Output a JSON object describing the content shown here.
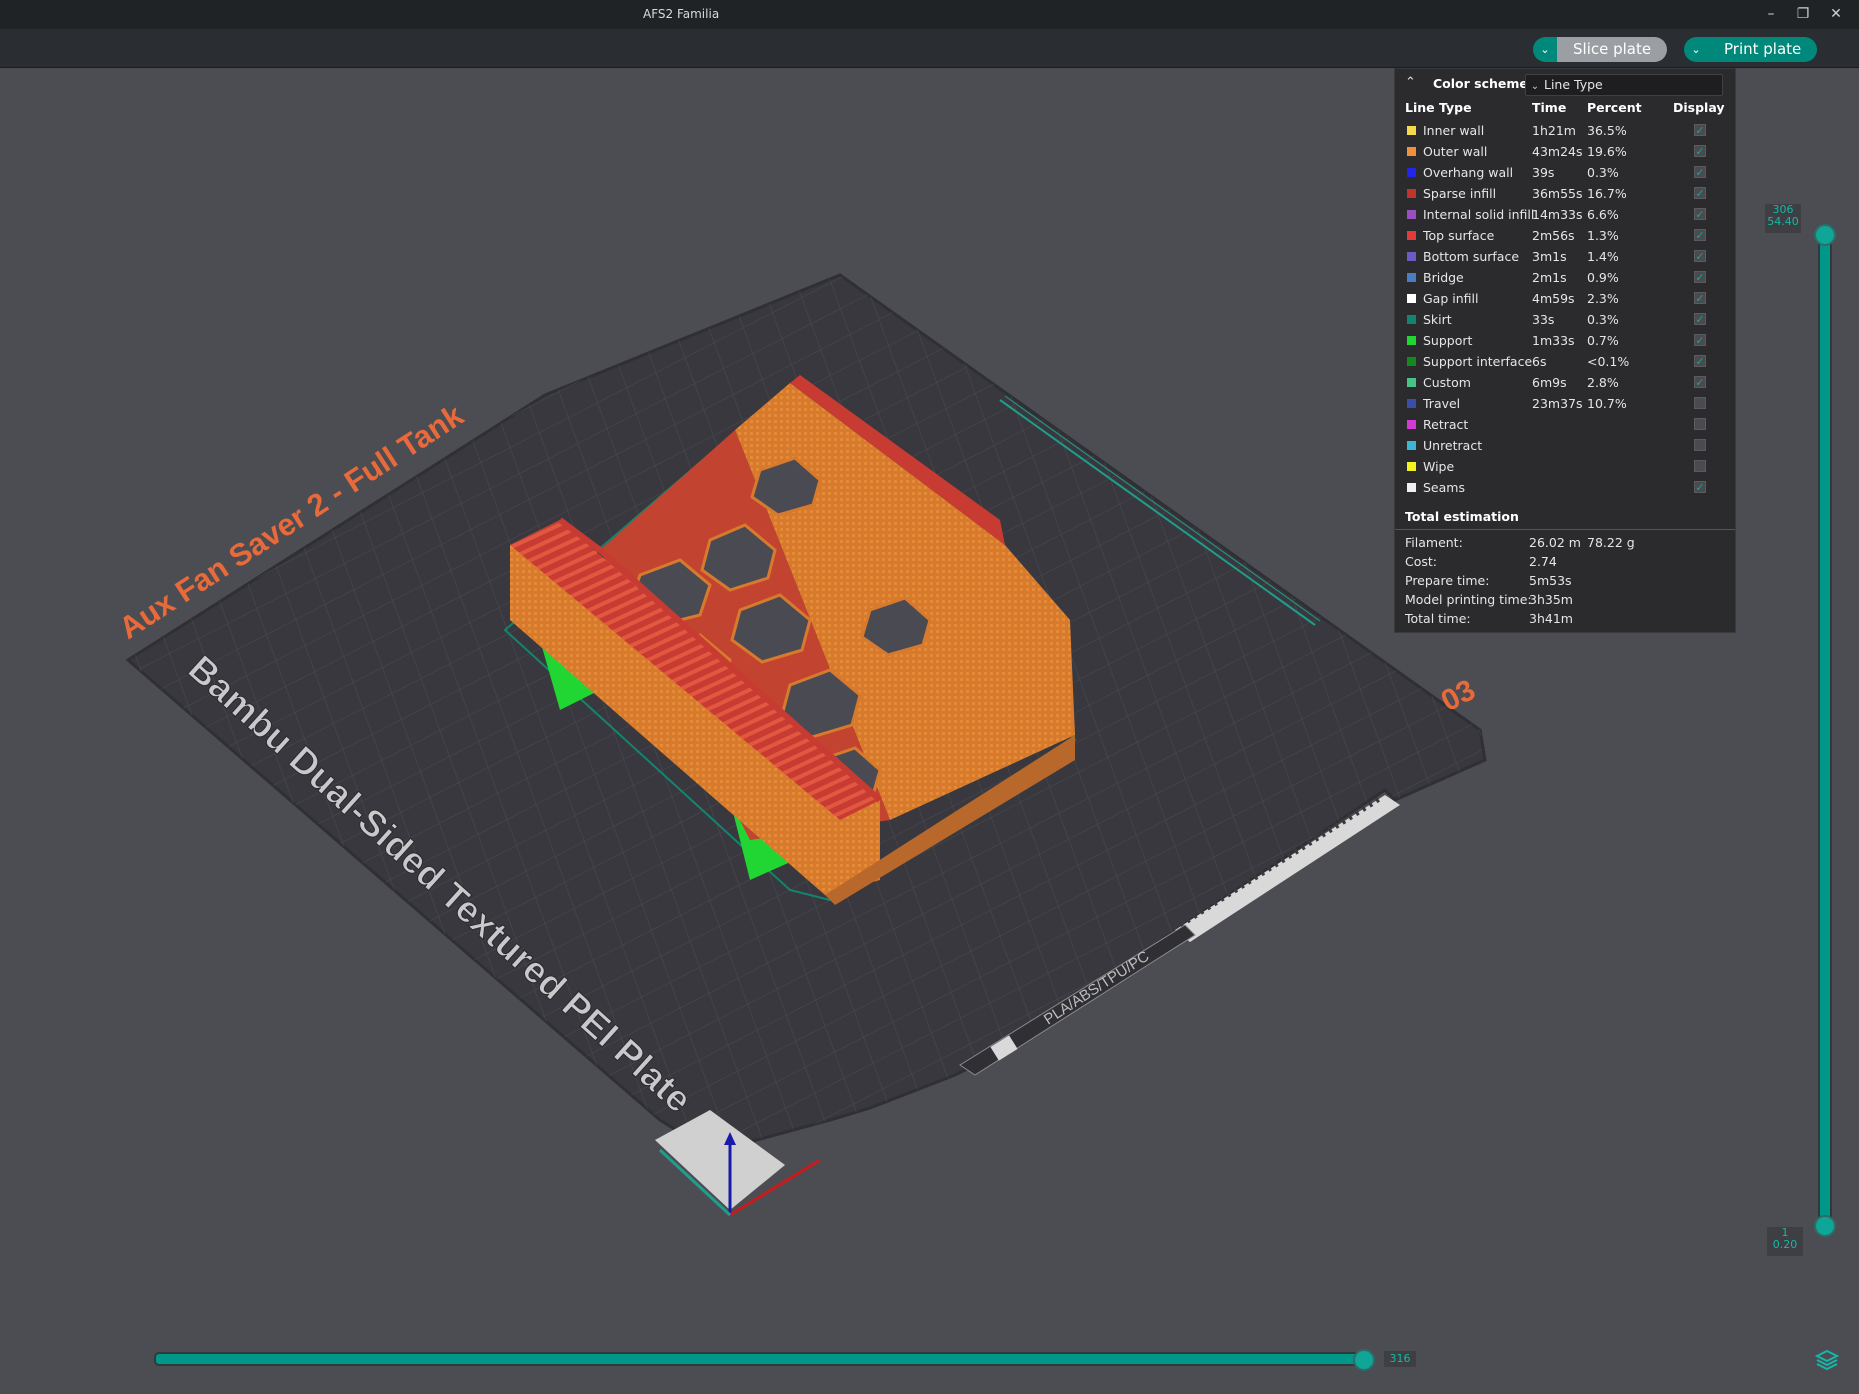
{
  "window": {
    "title": "AFS2 Familia",
    "controls": [
      "minimize-icon",
      "restore-icon",
      "close-icon"
    ]
  },
  "toolbar": {
    "slice_label": "Slice plate",
    "print_label": "Print plate",
    "accent_color": "#00897b"
  },
  "plate": {
    "model_name": "Aux Fan Saver 2 - Full Tank",
    "plate_type": "Bambu Dual-Sided Textured PEI Plate",
    "plate_number": "03",
    "material_label": "PLA/ABS/TPU/PC"
  },
  "legend": {
    "color_scheme_label": "Color scheme",
    "color_scheme_value": "Line Type",
    "headers": {
      "line_type": "Line Type",
      "time": "Time",
      "percent": "Percent",
      "display": "Display"
    },
    "rows": [
      {
        "name": "Inner wall",
        "time": "1h21m",
        "percent": "36.5%",
        "color": "#f5d94d",
        "display": true
      },
      {
        "name": "Outer wall",
        "time": "43m24s",
        "percent": "19.6%",
        "color": "#f08f3c",
        "display": true
      },
      {
        "name": "Overhang wall",
        "time": "39s",
        "percent": "0.3%",
        "color": "#2226e8",
        "display": true
      },
      {
        "name": "Sparse infill",
        "time": "36m55s",
        "percent": "16.7%",
        "color": "#c0342b",
        "display": true
      },
      {
        "name": "Internal solid infill",
        "time": "14m33s",
        "percent": "6.6%",
        "color": "#9a4fc0",
        "display": true
      },
      {
        "name": "Top surface",
        "time": "2m56s",
        "percent": "1.3%",
        "color": "#e23b3b",
        "display": true
      },
      {
        "name": "Bottom surface",
        "time": "3m1s",
        "percent": "1.4%",
        "color": "#6a5cc4",
        "display": true
      },
      {
        "name": "Bridge",
        "time": "2m1s",
        "percent": "0.9%",
        "color": "#4a7dc4",
        "display": true
      },
      {
        "name": "Gap infill",
        "time": "4m59s",
        "percent": "2.3%",
        "color": "#ffffff",
        "display": true
      },
      {
        "name": "Skirt",
        "time": "33s",
        "percent": "0.3%",
        "color": "#13846f",
        "display": true
      },
      {
        "name": "Support",
        "time": "1m33s",
        "percent": "0.7%",
        "color": "#21d633",
        "display": true
      },
      {
        "name": "Support interface",
        "time": "6s",
        "percent": "<0.1%",
        "color": "#138a1f",
        "display": true
      },
      {
        "name": "Custom",
        "time": "6m9s",
        "percent": "2.8%",
        "color": "#45c485",
        "display": true
      },
      {
        "name": "Travel",
        "time": "23m37s",
        "percent": "10.7%",
        "color": "#3a4ea8",
        "display": false
      },
      {
        "name": "Retract",
        "time": "",
        "percent": "",
        "color": "#d23bd1",
        "display": false
      },
      {
        "name": "Unretract",
        "time": "",
        "percent": "",
        "color": "#3bb7d2",
        "display": false
      },
      {
        "name": "Wipe",
        "time": "",
        "percent": "",
        "color": "#f2f21c",
        "display": false
      },
      {
        "name": "Seams",
        "time": "",
        "percent": "",
        "color": "#f0f0f0",
        "display": true
      }
    ],
    "total_title": "Total estimation",
    "estimates": [
      {
        "key": "Filament:",
        "value": "26.02 m",
        "value2": "78.22 g"
      },
      {
        "key": "Cost:",
        "value": "2.74",
        "value2": ""
      },
      {
        "key": "Prepare time:",
        "value": "5m53s",
        "value2": ""
      },
      {
        "key": "Model printing time:",
        "value": "3h35m",
        "value2": ""
      },
      {
        "key": "Total time:",
        "value": "3h41m",
        "value2": ""
      }
    ]
  },
  "layer_slider": {
    "top_layer": "306",
    "top_height": "54.40",
    "bottom_layer": "1",
    "bottom_height": "0.20"
  },
  "move_slider": {
    "value": "316"
  }
}
